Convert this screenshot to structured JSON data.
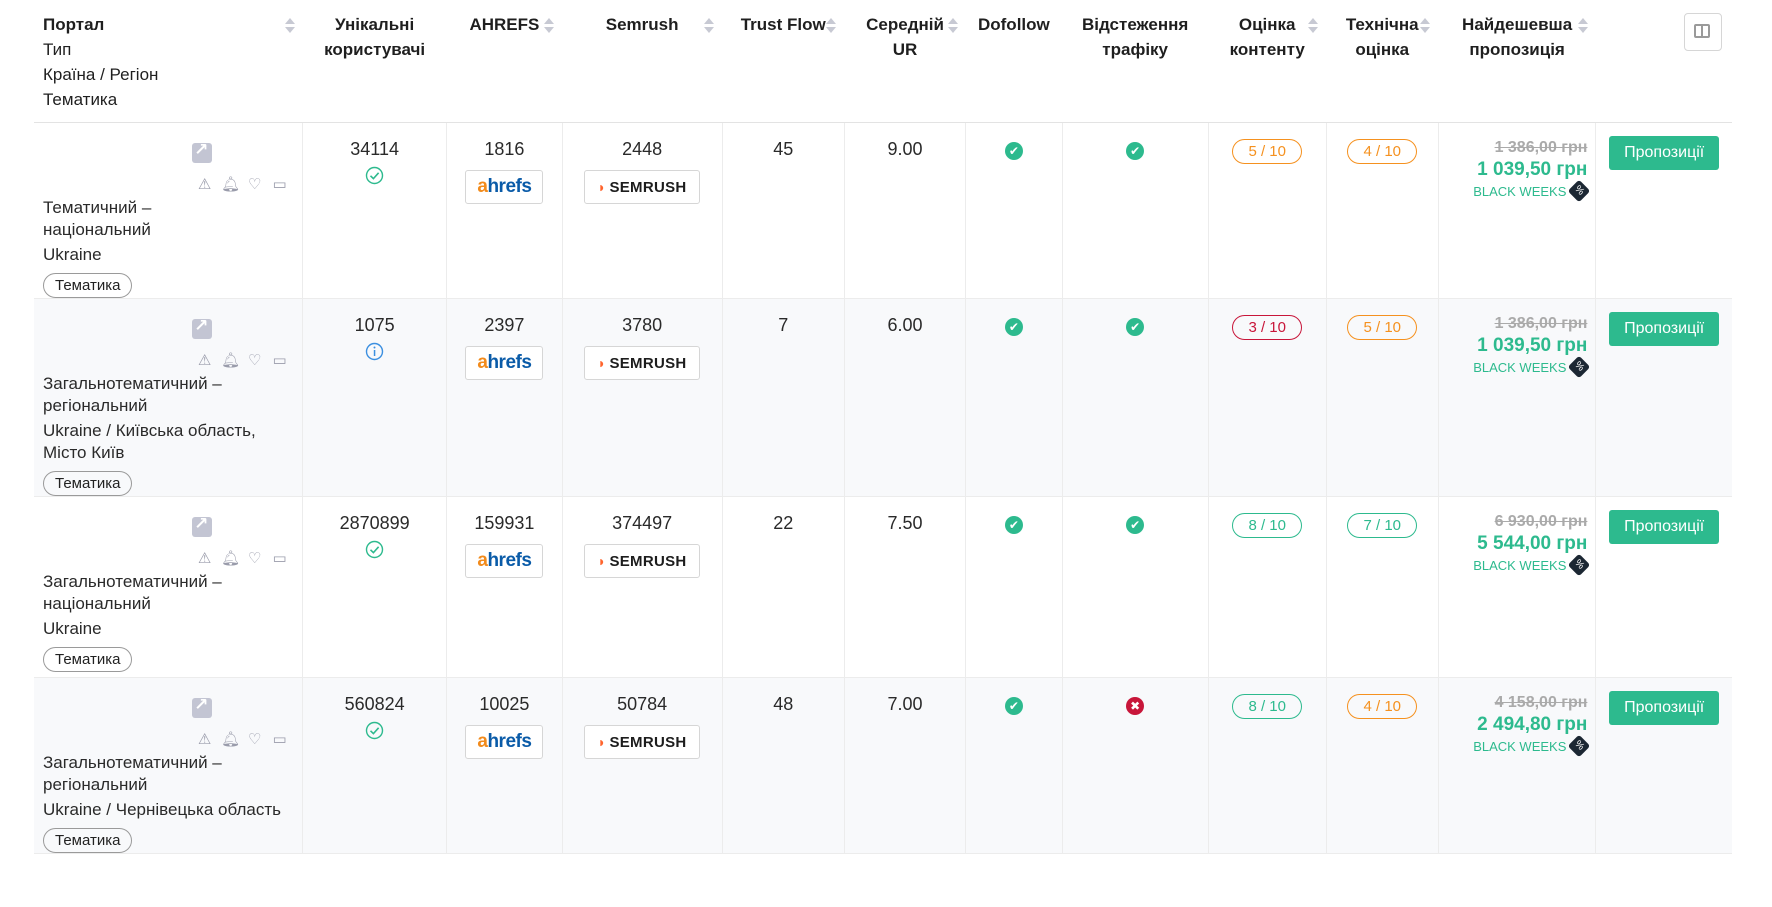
{
  "header": {
    "portal": [
      "Портал",
      "Тип",
      "Країна / Регіон",
      "Тематика"
    ],
    "unique_users": [
      "Унікальні",
      "користувачі"
    ],
    "ahrefs": "AHREFS",
    "semrush": "Semrush",
    "trust_flow": "Trust Flow",
    "avg_ur": [
      "Середній",
      "UR"
    ],
    "dofollow": "Dofollow",
    "tracking": [
      "Відстеження",
      "трафіку"
    ],
    "content_score": [
      "Оцінка",
      "контенту"
    ],
    "tech_score": [
      "Технічна",
      "оцінка"
    ],
    "cheapest": [
      "Найдешевша",
      "пропозиція"
    ]
  },
  "brand": {
    "ahrefs_a": "a",
    "ahrefs_rest": "hrefs",
    "semrush": "SEMRUSH"
  },
  "colors": {
    "accent_green": "#2dba8e",
    "warning_orange": "#f5911f",
    "danger_red": "#c8163a"
  },
  "rows": [
    {
      "type": [
        "Тематичний –",
        "національний"
      ],
      "country": [
        "Ukraine"
      ],
      "tag": "Тематика",
      "users": "34114",
      "users_status": "verified",
      "ahrefs": "1816",
      "semrush": "2448",
      "trust_flow": "45",
      "ur": "9.00",
      "dofollow": true,
      "tracking": true,
      "content": "5 / 10",
      "content_level": "orange",
      "tech": "4 / 10",
      "tech_level": "orange",
      "old_price": "1 386,00 грн",
      "new_price": "1 039,50 грн",
      "promo": "BLACK WEEKS",
      "button": "Пропозиції"
    },
    {
      "type": [
        "Загальнотематичний –",
        "регіональний"
      ],
      "country": [
        "Ukraine / Київська область,",
        "Місто Київ"
      ],
      "tag": "Тематика",
      "users": "1075",
      "users_status": "info",
      "ahrefs": "2397",
      "semrush": "3780",
      "trust_flow": "7",
      "ur": "6.00",
      "dofollow": true,
      "tracking": true,
      "content": "3 / 10",
      "content_level": "red",
      "tech": "5 / 10",
      "tech_level": "orange",
      "old_price": "1 386,00 грн",
      "new_price": "1 039,50 грн",
      "promo": "BLACK WEEKS",
      "button": "Пропозиції"
    },
    {
      "type": [
        "Загальнотематичний –",
        "національний"
      ],
      "country": [
        "Ukraine"
      ],
      "tag": "Тематика",
      "users": "2870899",
      "users_status": "verified",
      "ahrefs": "159931",
      "semrush": "374497",
      "trust_flow": "22",
      "ur": "7.50",
      "dofollow": true,
      "tracking": true,
      "content": "8 / 10",
      "content_level": "green",
      "tech": "7 / 10",
      "tech_level": "green",
      "old_price": "6 930,00 грн",
      "new_price": "5 544,00 грн",
      "promo": "BLACK WEEKS",
      "button": "Пропозиції"
    },
    {
      "type": [
        "Загальнотематичний –",
        "регіональний"
      ],
      "country": [
        "Ukraine / Чернівецька область"
      ],
      "tag": "Тематика",
      "users": "560824",
      "users_status": "verified",
      "ahrefs": "10025",
      "semrush": "50784",
      "trust_flow": "48",
      "ur": "7.00",
      "dofollow": true,
      "tracking": false,
      "content": "8 / 10",
      "content_level": "green",
      "tech": "4 / 10",
      "tech_level": "orange",
      "old_price": "4 158,00 грн",
      "new_price": "2 494,80 грн",
      "promo": "BLACK WEEKS",
      "button": "Пропозиції"
    }
  ]
}
